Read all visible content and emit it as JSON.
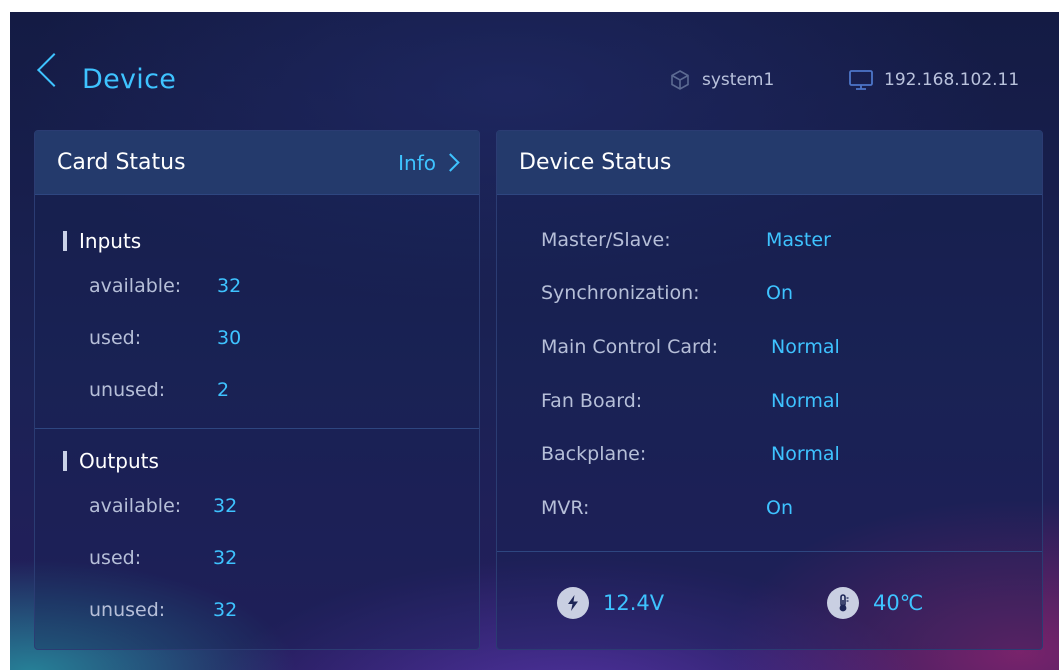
{
  "header": {
    "title": "Device",
    "system_label": "system1",
    "ip_label": "192.168.102.11",
    "system_icon": "cube-icon",
    "ip_icon": "monitor-icon"
  },
  "card_status": {
    "title": "Card Status",
    "info_label": "Info",
    "inputs": {
      "title": "Inputs",
      "available_label": "available:",
      "available_value": "32",
      "used_label": "used:",
      "used_value": "30",
      "unused_label": "unused:",
      "unused_value": "2"
    },
    "outputs": {
      "title": "Outputs",
      "available_label": "available:",
      "available_value": "32",
      "used_label": "used:",
      "used_value": "32",
      "unused_label": "unused:",
      "unused_value": "32"
    }
  },
  "device_status": {
    "title": "Device Status",
    "rows": [
      {
        "label": "Master/Slave:",
        "value": "Master"
      },
      {
        "label": "Synchronization:",
        "value": "On"
      },
      {
        "label": "Main Control Card:",
        "value": "Normal"
      },
      {
        "label": "Fan Board:",
        "value": "Normal"
      },
      {
        "label": "Backplane:",
        "value": "Normal"
      },
      {
        "label": "MVR:",
        "value": "On"
      }
    ],
    "voltage": "12.4V",
    "temperature": "40℃"
  },
  "colors": {
    "accent": "#3ec3ff",
    "panel_header": "#243a6c",
    "label_text": "#b6bfd8",
    "background": "#1b2255"
  }
}
